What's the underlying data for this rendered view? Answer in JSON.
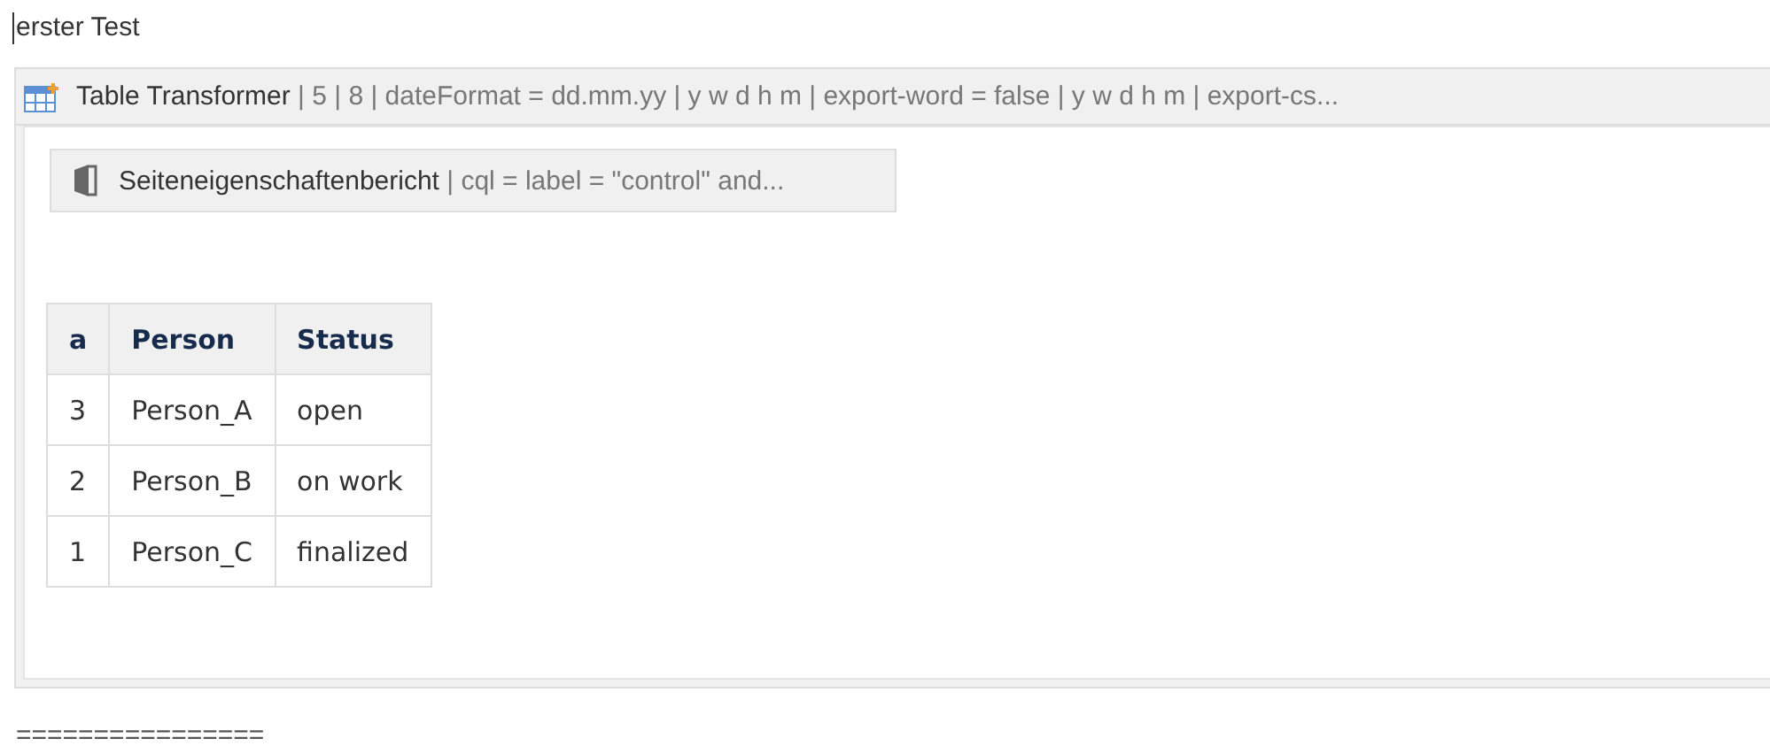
{
  "heading": "erster Test",
  "macro": {
    "title": "Table Transformer",
    "params": " | 5 | 8 | dateFormat = dd.mm.yy | y w d h m | export-word = false | y w d h m | export-cs...",
    "inner_macro": {
      "title": "Seiteneigenschaftenbericht",
      "params": " | cql = label = \"control\" and..."
    },
    "table": {
      "columns": [
        "a",
        "Person",
        "Status"
      ],
      "rows": [
        [
          "3",
          "Person_A",
          "open"
        ],
        [
          "2",
          "Person_B",
          "on work"
        ],
        [
          "1",
          "Person_C",
          "finalized"
        ]
      ]
    }
  },
  "footer": "================"
}
